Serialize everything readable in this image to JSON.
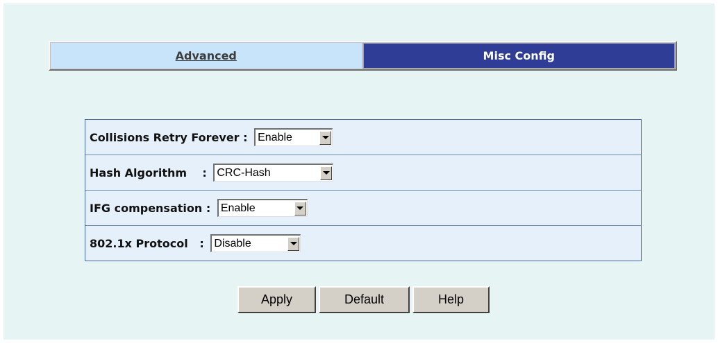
{
  "tabs": [
    {
      "label": "Advanced",
      "active": false
    },
    {
      "label": "Misc Config",
      "active": true
    }
  ],
  "settings": [
    {
      "label": "Collisions Retry Forever : ",
      "value": "Enable"
    },
    {
      "label": "Hash Algorithm    : ",
      "value": "CRC-Hash"
    },
    {
      "label": "IFG compensation : ",
      "value": "Enable"
    },
    {
      "label": "802.1x Protocol   : ",
      "value": "Disable"
    }
  ],
  "buttons": {
    "apply": "Apply",
    "default": "Default",
    "help": "Help"
  },
  "colors": {
    "page_bg": "#e6f4f4",
    "tab_inactive": "#c8e4fa",
    "tab_active": "#2f3d96",
    "table_bg": "#e6f0fa"
  },
  "icons": {
    "dropdown": "chevron-down-icon"
  }
}
